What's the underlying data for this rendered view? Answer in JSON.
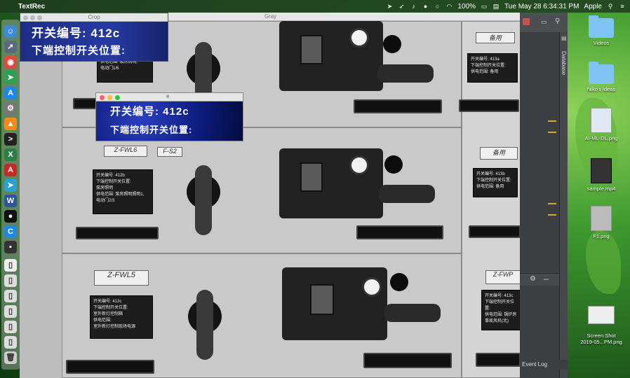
{
  "menubar": {
    "app_name": "TextRec",
    "clock": "Tue May 28  6:34:31 PM",
    "battery": "100%",
    "user": "Apple"
  },
  "crop_window": {
    "title": "Crop",
    "line1": "开关编号: 412c",
    "line2": "下端控制开关位置:"
  },
  "gray_window": {
    "title": "Gray",
    "tags": [
      "备用",
      "Z-FWL6",
      "F-S2",
      "备用",
      "Z-FWL5",
      "Z-FWP"
    ],
    "label_cards": [
      {
        "lines": [
          "供电范围: 泵房照明,",
          "电动门1/6"
        ]
      },
      {
        "lines": [
          "开关编号: 413a",
          "下端控制开关位置:",
          "供电范围: 备用"
        ]
      },
      {
        "lines": [
          "开关编号: 412b",
          "下端控制开关位置:",
          "泵房照明",
          "供电范围: 泵房照明照明1,",
          "电动门2/3"
        ]
      },
      {
        "lines": [
          "开关编号: 413b",
          "下端控制开关位置:",
          "供电范围: 备用"
        ]
      },
      {
        "lines": [
          "开关编号: 412c",
          "下端控制开关位置:",
          "室外新灯控制箱",
          "供电范围:",
          "室外新灯控制现场电源"
        ]
      },
      {
        "lines": [
          "开关编号: 413c",
          "下端控制开关位置:",
          "供电范围: 锅炉房",
          "事故风机(北)"
        ]
      }
    ]
  },
  "small_window": {
    "title_glyph": "e",
    "line1": "开关编号: 412c",
    "line2": "下端控制开关位置:"
  },
  "ide": {
    "database_tab": "Database",
    "event_log": "Event Log"
  },
  "desktop_icons": [
    {
      "label": "Videos",
      "type": "folder"
    },
    {
      "label": "Niko's ideas",
      "type": "folder"
    },
    {
      "label": "AI-ML-DL.png",
      "type": "image"
    },
    {
      "label": "sample.mp4",
      "type": "video"
    },
    {
      "label": "F1.png",
      "type": "image"
    },
    {
      "label": "Screen Shot\n2019-05...PM.png",
      "type": "image"
    }
  ],
  "colors": {
    "crop_bg": "#1d2c86",
    "ide_bg": "#3b3f41",
    "ide_marker": "#e0a52a"
  }
}
